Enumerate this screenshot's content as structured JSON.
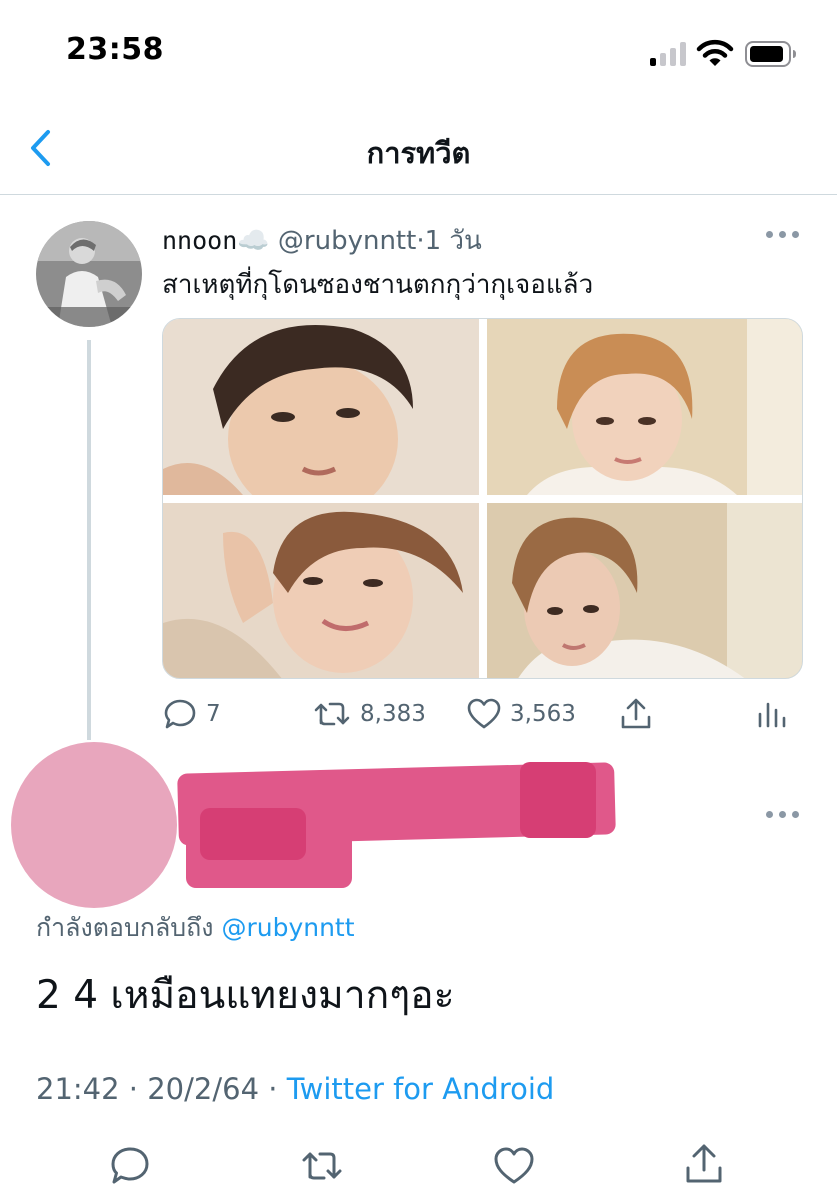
{
  "status_bar": {
    "time": "23:58",
    "icons": [
      "signal-icon",
      "wifi-icon",
      "battery-icon"
    ]
  },
  "nav": {
    "back_icon": "chevron-left-icon",
    "title": "การทวีต"
  },
  "parent_tweet": {
    "display_name": "nnoon",
    "name_emoji": "☁️",
    "handle": "@rubynntt",
    "separator": "·",
    "time": "1 วัน",
    "text": "สาเหตุที่กุโดนซองชานตกกุว่ากุเจอแล้ว",
    "media_count": 4,
    "actions": {
      "replies": "7",
      "retweets": "8,383",
      "likes": "3,563"
    }
  },
  "reply_tweet": {
    "replying_to_prefix": "กำลังตอบกลับถึง",
    "replying_to_handle": "@rubynntt",
    "text": "2 4 เหมือนแทยงมากๆอะ",
    "time": "21:42",
    "separator": "·",
    "date": "20/2/64",
    "source": "Twitter for Android"
  },
  "colors": {
    "accent": "#1d9bf0",
    "secondary_text": "#536471",
    "divider": "#cfd9de",
    "redaction": "#e0588a",
    "avatar_redaction": "#e8a6bd"
  }
}
